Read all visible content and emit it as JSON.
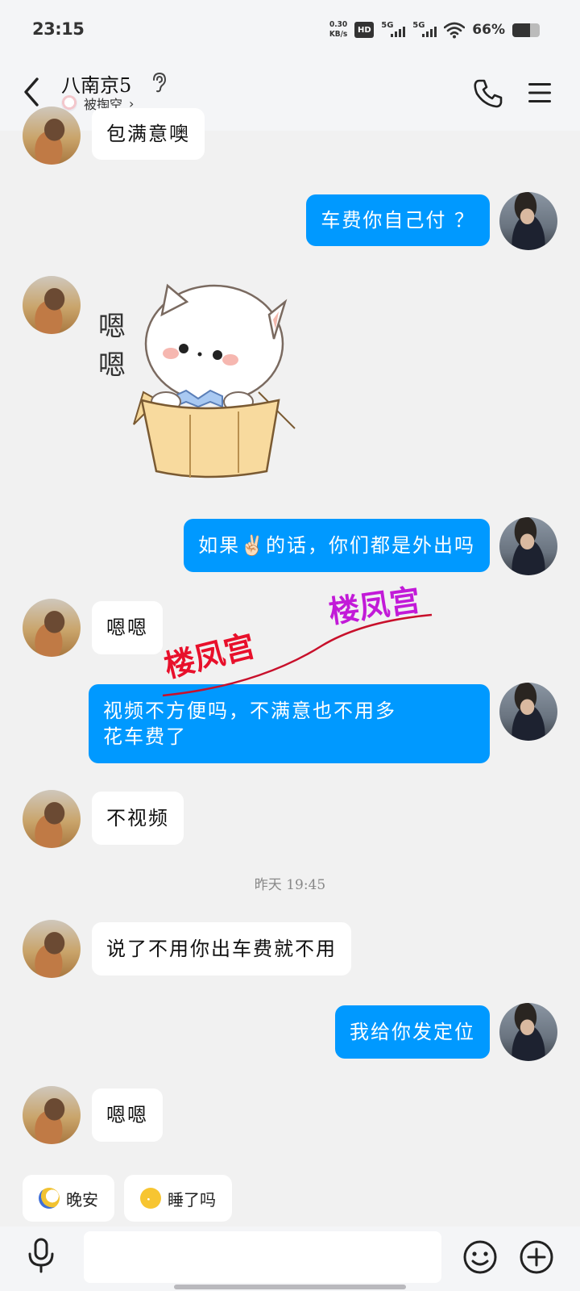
{
  "status_bar": {
    "time": "23:15",
    "net_speed_value": "0.30",
    "net_speed_unit": "KB/s",
    "hd_label": "HD",
    "signal_1_label": "5G",
    "signal_2_label": "5G",
    "battery_percent": "66%",
    "battery_level": 0.66,
    "icons": [
      "hd-icon",
      "signal-icon",
      "signal-icon",
      "wifi-icon",
      "battery-icon"
    ]
  },
  "header": {
    "contact_name": "八南京5",
    "sub_status": "被掏空",
    "icons": [
      "back-icon",
      "ear-icon",
      "phone-icon",
      "menu-icon"
    ]
  },
  "messages": [
    {
      "id": "m0",
      "side": "in",
      "text": "包满意噢"
    },
    {
      "id": "m1",
      "side": "out",
      "text": "车费你自己付 ？"
    },
    {
      "id": "m2",
      "side": "in",
      "type": "sticker",
      "sticker_text_1": "嗯",
      "sticker_text_2": "嗯"
    },
    {
      "id": "m3",
      "side": "out",
      "text": "如果✌🏻的话，你们都是外出吗"
    },
    {
      "id": "m4",
      "side": "in",
      "text": "嗯嗯"
    },
    {
      "id": "m5",
      "side": "out",
      "text": "视频不方便吗，不满意也不用多\n花车费了"
    },
    {
      "id": "m6",
      "side": "in",
      "text": "不视频"
    },
    {
      "id": "m7",
      "side": "in",
      "text": "说了不用你出车费就不用"
    },
    {
      "id": "m8",
      "side": "out",
      "text": "我给你发定位"
    },
    {
      "id": "m9",
      "side": "in",
      "text": "嗯嗯"
    }
  ],
  "timestamp": "昨天 19:45",
  "watermarks": {
    "red": "楼凤宫",
    "purple": "楼凤宫",
    "red_color": "#e8102b",
    "purple_color": "#c21ad8"
  },
  "quick_replies": [
    {
      "label": "晚安",
      "icon": "moon-icon"
    },
    {
      "label": "睡了吗",
      "icon": "sleepy-face-icon"
    }
  ],
  "input_bar": {
    "value": "",
    "icons": [
      "mic-icon",
      "emoji-icon",
      "plus-icon"
    ]
  },
  "colors": {
    "outgoing_bubble": "#0099ff",
    "incoming_bubble": "#ffffff",
    "background": "#f1f1f1"
  }
}
